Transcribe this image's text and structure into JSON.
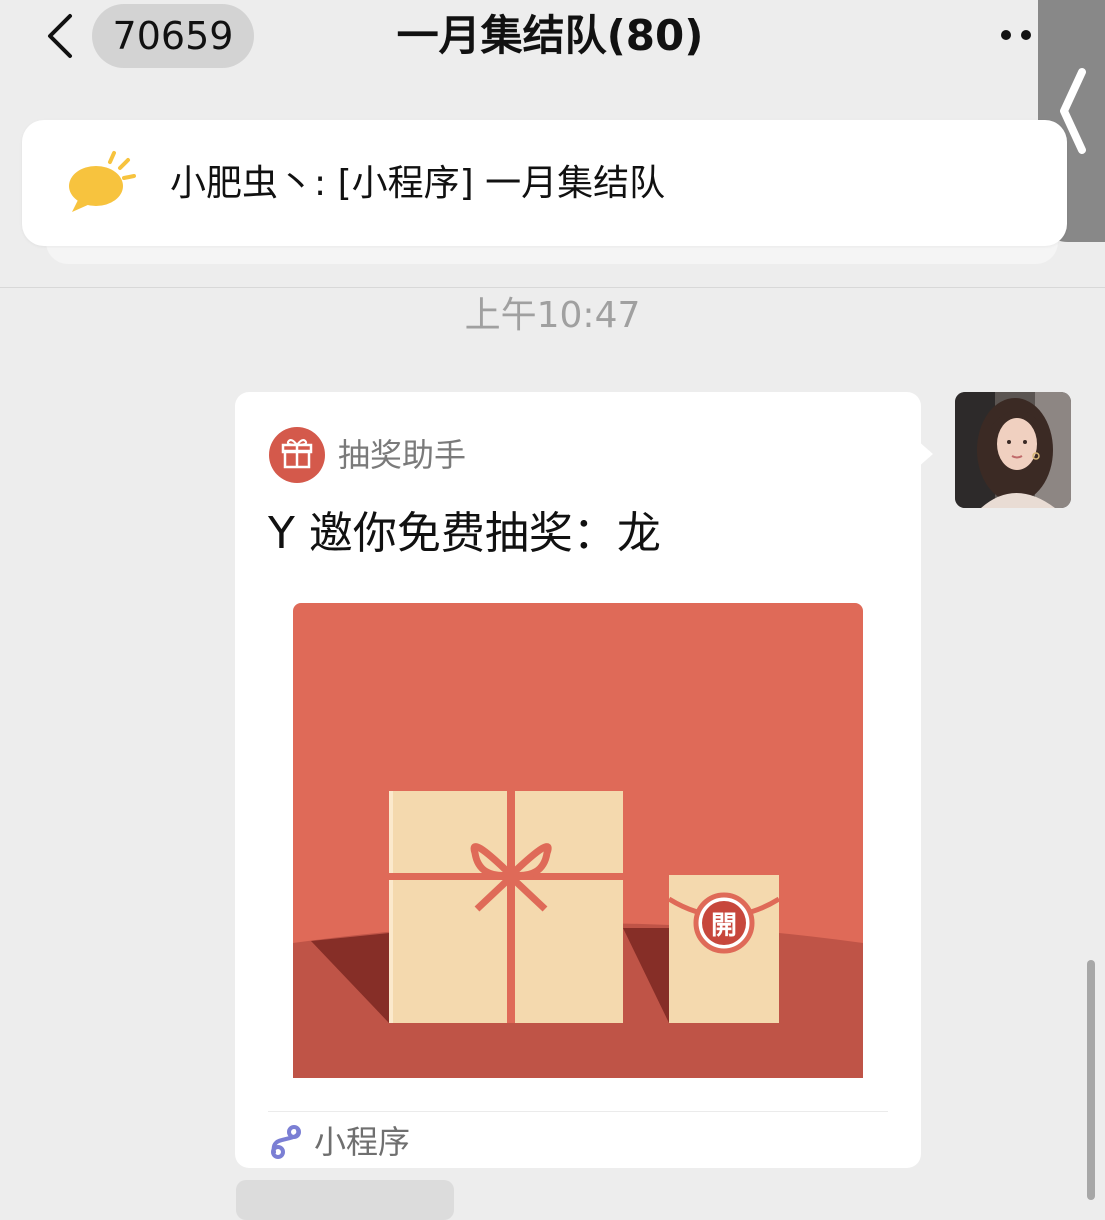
{
  "header": {
    "unread_count": "70659",
    "title": "一月集结队(80)"
  },
  "pinned": {
    "text": "小肥虫丶: [小程序] 一月集结队"
  },
  "timestamp": "上午10:47",
  "message": {
    "app_name": "抽奖助手",
    "title": "Y 邀你免费抽奖：龙",
    "open_char": "開",
    "footer_label": "小程序",
    "image_colors": {
      "background": "#df6a58",
      "table": "#bf5447",
      "shadow": "#862e27",
      "box": "#f4d9ae",
      "ribbon": "#df6a58"
    }
  },
  "icons": {
    "back": "chevron-left-icon",
    "more": "more-dots-icon",
    "pin": "speech-bubble-icon",
    "app": "gift-icon",
    "mini_program": "mini-program-icon",
    "edge_tab": "chevron-left-icon"
  }
}
